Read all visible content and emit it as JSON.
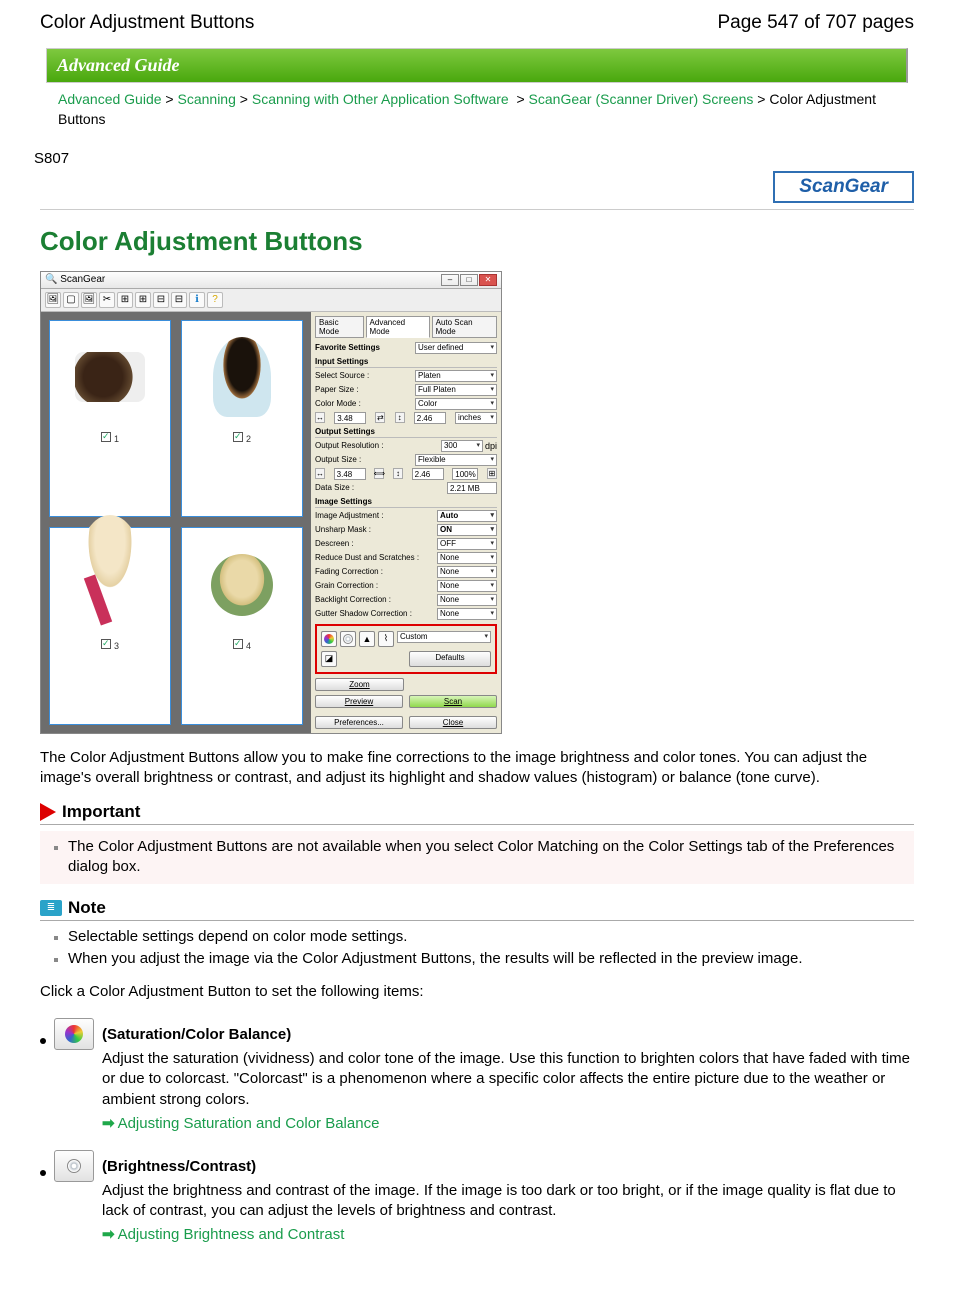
{
  "header": {
    "title_left": "Color Adjustment Buttons",
    "title_right": "Page 547 of 707 pages"
  },
  "banner": "Advanced Guide",
  "breadcrumbs": {
    "items": [
      "Advanced Guide",
      "Scanning",
      "Scanning with Other Application Software",
      "ScanGear (Scanner Driver) Screens"
    ],
    "current": "Color Adjustment Buttons"
  },
  "ref_code": "S807",
  "brand": "ScanGear",
  "page_title": "Color Adjustment Buttons",
  "screenshot": {
    "win_title": "ScanGear",
    "thumbs": [
      "1",
      "2",
      "3",
      "4"
    ],
    "tabs": [
      "Basic Mode",
      "Advanced Mode",
      "Auto Scan Mode"
    ],
    "fav_label": "Favorite Settings",
    "fav_value": "User defined",
    "input_h": "Input Settings",
    "select_source_l": "Select Source :",
    "select_source_v": "Platen",
    "paper_l": "Paper Size :",
    "paper_v": "Full Platen",
    "colormode_l": "Color Mode :",
    "colormode_v": "Color",
    "dim_w": "3.48",
    "dim_h": "2.46",
    "dim_unit": "inches",
    "output_h": "Output Settings",
    "res_l": "Output Resolution :",
    "res_v": "300",
    "res_u": "dpi",
    "outsize_l": "Output Size :",
    "outsize_v": "Flexible",
    "out_w": "3.48",
    "out_h": "2.46",
    "out_pct": "100%",
    "data_l": "Data Size :",
    "data_v": "2.21 MB",
    "img_h": "Image Settings",
    "img_rows": [
      {
        "l": "Image Adjustment :",
        "v": "Auto",
        "b": true
      },
      {
        "l": "Unsharp Mask :",
        "v": "ON",
        "b": true
      },
      {
        "l": "Descreen :",
        "v": "OFF",
        "b": false
      },
      {
        "l": "Reduce Dust and Scratches :",
        "v": "None",
        "b": false
      },
      {
        "l": "Fading Correction :",
        "v": "None",
        "b": false
      },
      {
        "l": "Grain Correction :",
        "v": "None",
        "b": false
      },
      {
        "l": "Backlight Correction :",
        "v": "None",
        "b": false
      },
      {
        "l": "Gutter Shadow Correction :",
        "v": "None",
        "b": false
      }
    ],
    "custom": "Custom",
    "defaults": "Defaults",
    "zoom": "Zoom",
    "preview": "Preview",
    "scan": "Scan",
    "prefs": "Preferences...",
    "close": "Close"
  },
  "intro": "The Color Adjustment Buttons allow you to make fine corrections to the image brightness and color tones. You can adjust the image's overall brightness or contrast, and adjust its highlight and shadow values (histogram) or balance (tone curve).",
  "important": {
    "heading": "Important",
    "items": [
      "The Color Adjustment Buttons are not available when you select Color Matching on the Color Settings tab of the Preferences dialog box."
    ]
  },
  "note": {
    "heading": "Note",
    "items": [
      "Selectable settings depend on color mode settings.",
      "When you adjust the image via the Color Adjustment Buttons, the results will be reflected in the preview image."
    ]
  },
  "click_line": "Click a Color Adjustment Button to set the following items:",
  "features": [
    {
      "label": "(Saturation/Color Balance)",
      "desc": "Adjust the saturation (vividness) and color tone of the image. Use this function to brighten colors that have faded with time or due to colorcast. \"Colorcast\" is a phenomenon where a specific color affects the entire picture due to the weather or ambient strong colors.",
      "link": "Adjusting Saturation and Color Balance"
    },
    {
      "label": "(Brightness/Contrast)",
      "desc": "Adjust the brightness and contrast of the image. If the image is too dark or too bright, or if the image quality is flat due to lack of contrast, you can adjust the levels of brightness and contrast.",
      "link": "Adjusting Brightness and Contrast"
    }
  ]
}
